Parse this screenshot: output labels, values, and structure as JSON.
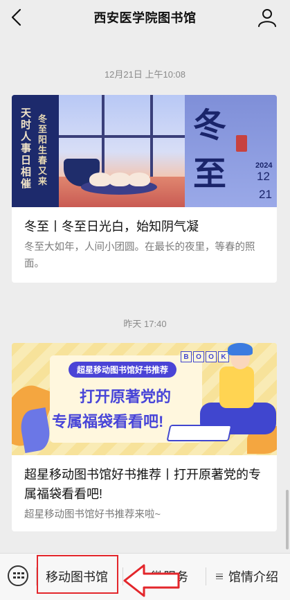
{
  "header": {
    "title": "西安医学院图书馆",
    "back_icon": "chevron-left-icon",
    "profile_icon": "user-icon"
  },
  "messages": [
    {
      "timestamp": "12月21日 上午10:08",
      "title": "冬至丨冬至日光白，始知阴气凝",
      "description": "冬至大如年，人间小团圆。在最长的夜里，等春的照面。",
      "banner": {
        "poem_col1": "天时人事日相催",
        "poem_col2": "冬至阳生春又来",
        "big_char1": "冬",
        "big_char2": "至",
        "year": "2024",
        "date_month": "12",
        "date_day": "21"
      }
    },
    {
      "timestamp": "昨天 17:40",
      "title": "超星移动图书馆好书推荐丨打开原著党的专属福袋看看吧!",
      "description": "超星移动图书馆好书推荐来啦~",
      "banner": {
        "pill": "超星移动图书馆好书推荐",
        "line1": "打开原著党的",
        "line2": "专属福袋看看吧!",
        "box_letters": [
          "B",
          "O",
          "O",
          "K"
        ]
      }
    }
  ],
  "menu": {
    "keyboard_icon": "keyboard-icon",
    "items": [
      {
        "label": "移动图书馆"
      },
      {
        "label": "微服务"
      },
      {
        "label": "馆情介绍"
      }
    ]
  },
  "colors": {
    "background": "#ededed",
    "highlight": "#e3262b",
    "accent_blue": "#4845d8"
  }
}
